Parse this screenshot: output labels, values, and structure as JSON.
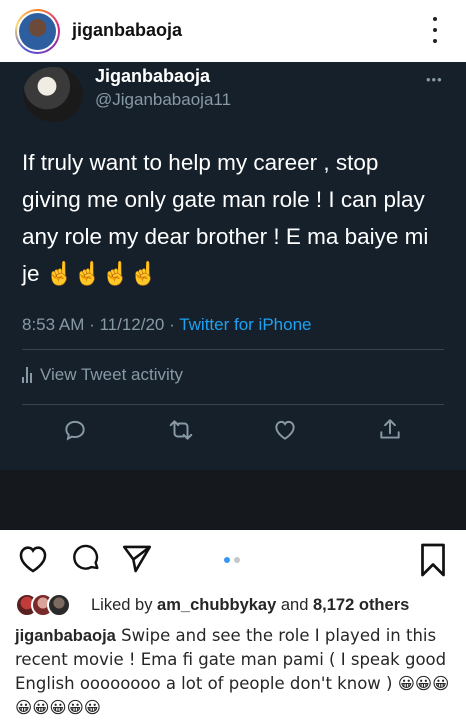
{
  "header": {
    "username": "jiganbabaoja"
  },
  "tweet": {
    "display_name": "Jiganbabaoja",
    "handle": "@Jiganbabaoja11",
    "text": "If  truly want to help my career , stop giving me only gate man role ! I can play any role my dear brother ! E ma baiye mi je ☝️☝️☝️☝️",
    "time": "8:53 AM · 11/12/20 · ",
    "source": "Twitter for iPhone",
    "activity_label": "View Tweet activity",
    "icons": [
      "reply-icon",
      "retweet-icon",
      "like-icon",
      "share-icon"
    ]
  },
  "post": {
    "carousel": {
      "count": 2,
      "active": 0
    },
    "liked_prefix": "Liked by ",
    "liked_user": "am_chubbykay",
    "liked_and": " and ",
    "liked_others": "8,172 others",
    "caption_user": "jiganbabaoja",
    "caption_text": " Swipe and see the role I played in this recent movie ! Ema fi gate man pami ( I speak good English oooooooo a lot of people don't know ) 😀😀😀😀😀😀😀😀"
  },
  "colors": {
    "tweet_bg": "#15202b",
    "twitter_blue": "#1da1f2",
    "muted": "#8899a6",
    "ig_blue": "#3897f0"
  }
}
